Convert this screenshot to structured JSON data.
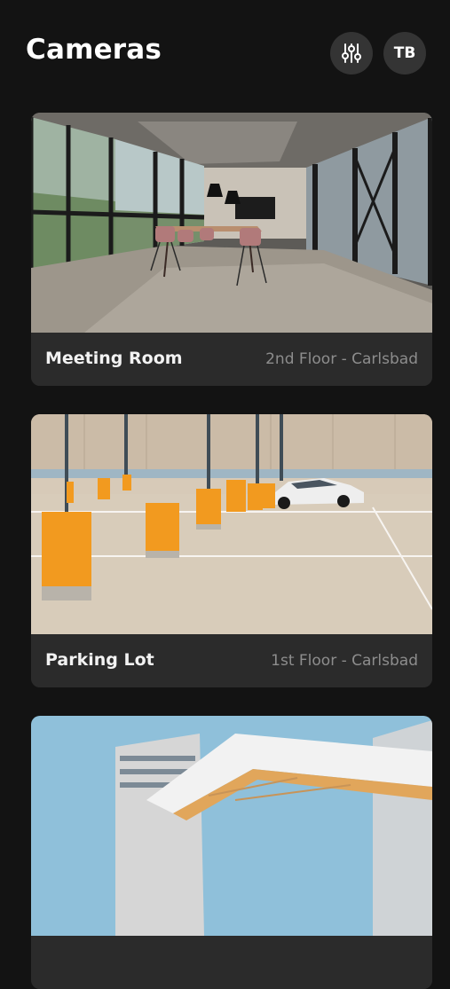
{
  "header": {
    "title": "Cameras",
    "filter_icon": "sliders-icon",
    "avatar_initials": "TB"
  },
  "cameras": [
    {
      "name": "Meeting Room",
      "location": "2nd Floor - Carlsbad"
    },
    {
      "name": "Parking Lot",
      "location": "1st Floor - Carlsbad"
    },
    {
      "name": "",
      "location": ""
    }
  ],
  "colors": {
    "background": "#131313",
    "card_caption": "#2b2b2b",
    "header_button": "#343434",
    "location_text": "#8d8d8d"
  }
}
